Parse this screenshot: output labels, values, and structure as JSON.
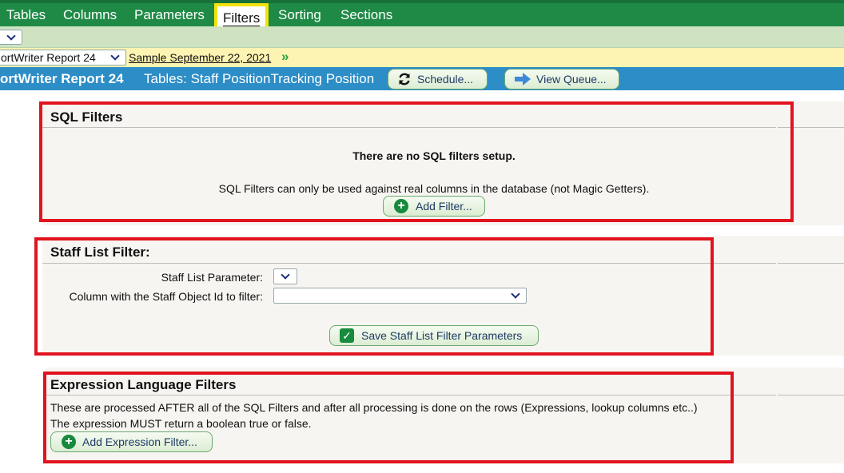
{
  "nav": {
    "tabs": [
      {
        "label": "Tables"
      },
      {
        "label": "Columns"
      },
      {
        "label": "Parameters"
      },
      {
        "label": "Filters",
        "active": true
      },
      {
        "label": "Sorting"
      },
      {
        "label": "Sections"
      }
    ],
    "accent_color": "#1f8a46",
    "highlight_color": "#f2e30c"
  },
  "report_bar": {
    "select_value": "ortWriter Report 24",
    "link_text": "Sample September 22, 2021",
    "forward_icon": "»"
  },
  "title_bar": {
    "title": "ortWriter Report 24",
    "subtitle": "Tables: Staff PositionTracking Position",
    "schedule_label": "Schedule...",
    "view_queue_label": "View Queue..."
  },
  "sql_filters": {
    "title": "SQL Filters",
    "empty_message": "There are no SQL filters setup.",
    "note": "SQL Filters can only be used against real columns in the database (not Magic Getters).",
    "add_label": "Add Filter..."
  },
  "staff_filter": {
    "title": "Staff List Filter:",
    "param_label": "Staff List Parameter:",
    "column_label": "Column with the Staff Object Id to filter:",
    "save_label": "Save Staff List Filter Parameters"
  },
  "expression_filters": {
    "title": "Expression Language Filters",
    "line1": "These are processed AFTER all of the SQL Filters and after all processing is done on the rows (Expressions, lookup columns etc..)",
    "line2": "The expression MUST return a boolean true or false.",
    "add_label": "Add Expression Filter..."
  },
  "colors": {
    "outline": "#e1141e",
    "title_bar": "#2d8dc6",
    "report_bar": "#fdf3b2",
    "button_text": "#1f3a66"
  }
}
